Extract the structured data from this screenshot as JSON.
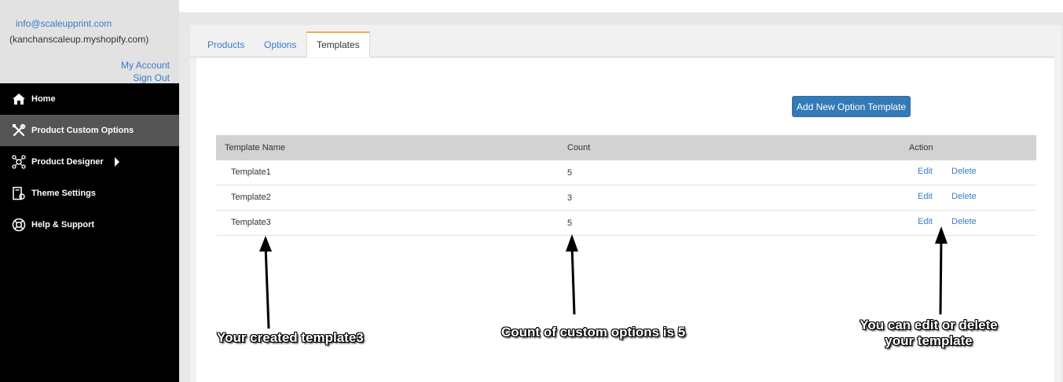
{
  "account": {
    "email": "info@scaleupprint.com",
    "shop": "(kanchanscaleup.myshopify.com)",
    "my_account": "My Account",
    "sign_out": "Sign Out"
  },
  "nav": {
    "items": [
      {
        "label": "Home",
        "icon": "home-icon"
      },
      {
        "label": "Product Custom Options",
        "icon": "tools-icon"
      },
      {
        "label": "Product Designer",
        "icon": "designer-icon"
      },
      {
        "label": "Theme Settings",
        "icon": "theme-settings-icon"
      },
      {
        "label": "Help & Support",
        "icon": "lifebuoy-icon"
      }
    ]
  },
  "tabs": [
    {
      "label": "Products"
    },
    {
      "label": "Options"
    },
    {
      "label": "Templates"
    }
  ],
  "add_button": "Add New Option Template",
  "table": {
    "headers": {
      "name": "Template Name",
      "count": "Count",
      "action": "Action"
    },
    "rows": [
      {
        "name": "Template1",
        "count": "5",
        "edit": "Edit",
        "delete": "Delete"
      },
      {
        "name": "Template2",
        "count": "3",
        "edit": "Edit",
        "delete": "Delete"
      },
      {
        "name": "Template3",
        "count": "5",
        "edit": "Edit",
        "delete": "Delete"
      }
    ]
  },
  "annotations": {
    "template": "Your created template3",
    "count": "Count of custom options is 5",
    "action_line1": "You can edit or delete",
    "action_line2": "your template"
  },
  "colors": {
    "accent": "#337ab7",
    "link": "#3a7bc8",
    "active_tab_border": "#f0ad4e",
    "sidebar_bg": "#000000",
    "sidebar_active": "#555555"
  }
}
